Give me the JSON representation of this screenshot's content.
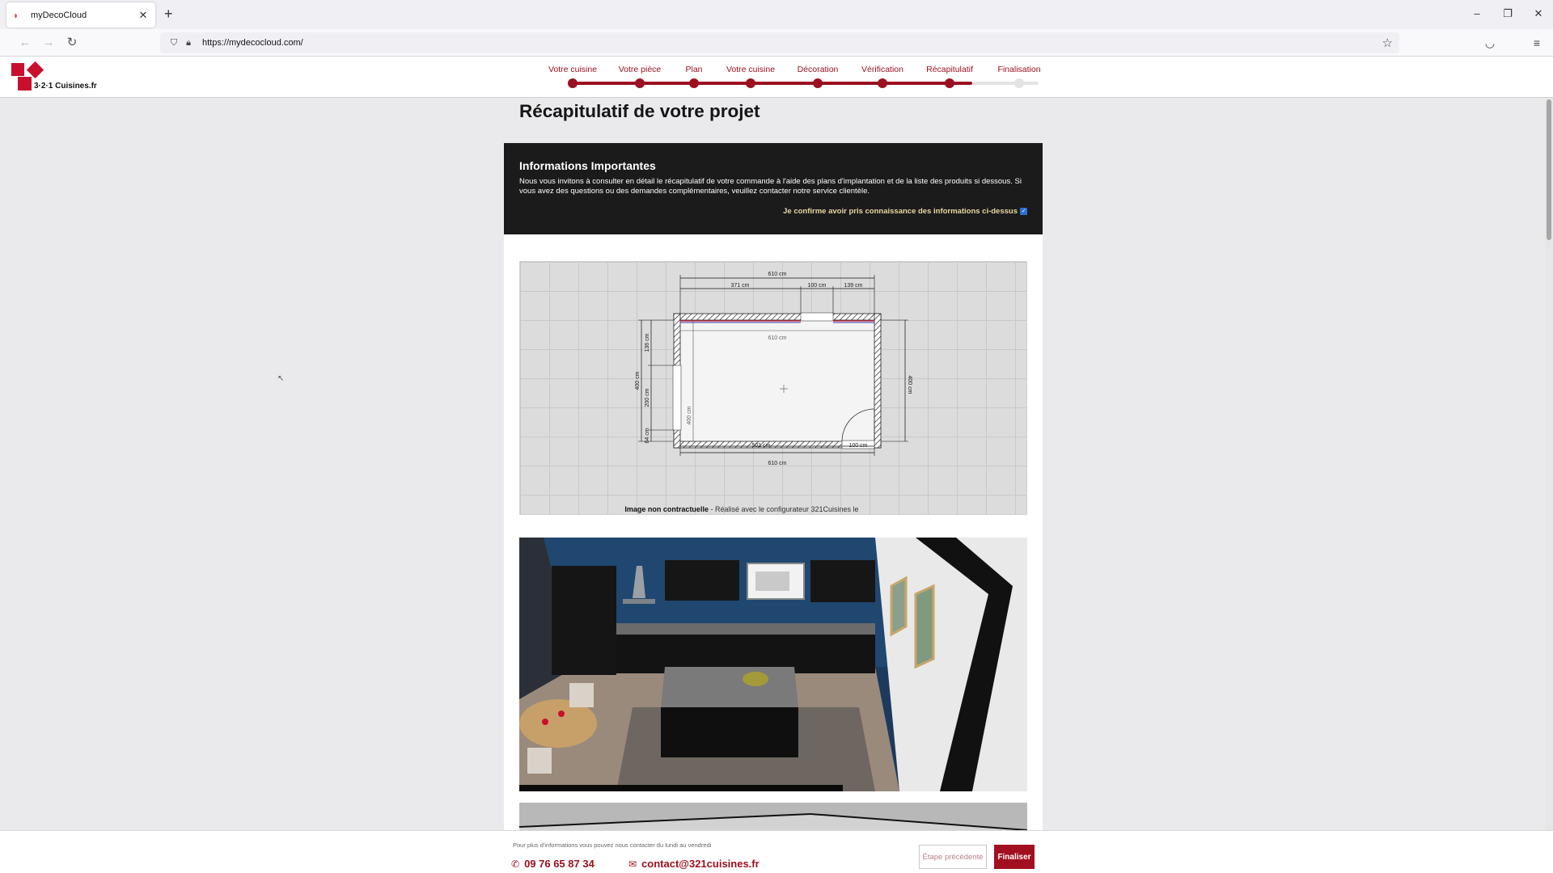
{
  "browser": {
    "tab_title": "myDecoCloud",
    "url": "https://mydecocloud.com/",
    "icons": [
      "back-icon",
      "forward-icon",
      "reload-icon",
      "shield-icon",
      "lock-icon",
      "star-icon",
      "pocket-icon",
      "menu-icon",
      "minimize-icon",
      "restore-icon",
      "close-icon"
    ]
  },
  "header": {
    "logo_text": "3·2·1 Cuisines.fr",
    "brand_color": "#c8102e"
  },
  "steps": {
    "items": [
      {
        "label": "Votre cuisine",
        "state": "done"
      },
      {
        "label": "Votre pièce",
        "state": "done"
      },
      {
        "label": "Plan",
        "state": "done"
      },
      {
        "label": "Votre cuisine",
        "state": "done"
      },
      {
        "label": "Décoration",
        "state": "done"
      },
      {
        "label": "Vérification",
        "state": "done"
      },
      {
        "label": "Récapitulatif",
        "state": "current"
      },
      {
        "label": "Finalisation",
        "state": "future"
      }
    ],
    "active_color": "#9b1020"
  },
  "main": {
    "title": "Récapitulatif de votre projet",
    "info": {
      "title": "Informations Importantes",
      "text": "Nous vous invitons à consulter en détail le récapitulatif de votre commande à l'aide des plans d'implantation et de la liste des produits si dessous. Si vous avez des questions ou des demandes complémentaires, veuillez contacter notre service clientèle.",
      "confirm_label": "Je confirme avoir pris connaissance des informations ci-dessus",
      "confirmed": true
    },
    "plan": {
      "dimensions": {
        "top_total": "610 cm",
        "top_left": "371 cm",
        "top_window": "100 cm",
        "top_right": "139 cm",
        "inner_width": "610 cm",
        "left_total": "400 cm",
        "left_top": "136 cm",
        "left_window": "200 cm",
        "left_bottom": "64 cm",
        "inner_height": "400 cm",
        "right_total": "400 cm",
        "bottom_left": "501 cm",
        "bottom_door": "100 cm",
        "bottom_total": "610 cm"
      },
      "caption_bold": "Image non contractuelle",
      "caption_rest": " - Réalisé avec le configurateur 321Cuisines le"
    }
  },
  "footer": {
    "note": "Pour plus d'informations vous pouvez nous contacter du lundi au vendredi",
    "phone": "09 76 65 87 34",
    "email": "contact@321cuisines.fr",
    "prev_label": "Étape précédente",
    "final_label": "Finaliser"
  }
}
